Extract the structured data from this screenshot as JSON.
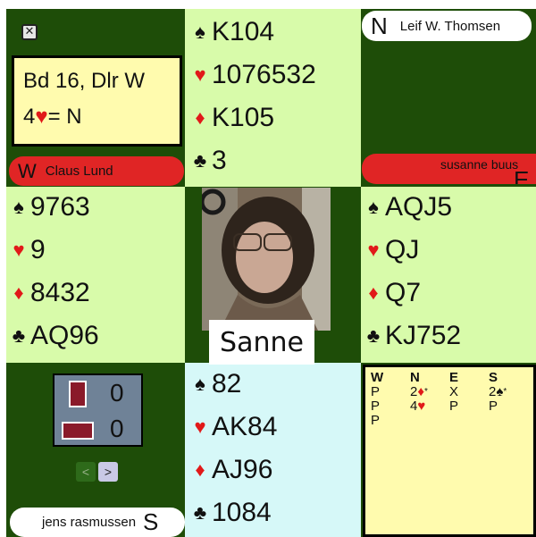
{
  "board": {
    "line1": "Bd 16, Dlr W",
    "level": "4",
    "suit_symbol": "♥",
    "declarer_text": "= N"
  },
  "players": {
    "north": {
      "seat": "N",
      "name": "Leif W. Thomsen"
    },
    "west": {
      "seat": "W",
      "name": "Claus Lund"
    },
    "east": {
      "seat": "E",
      "name": "susanne buus"
    },
    "south": {
      "seat": "S",
      "name": "jens rasmussen"
    }
  },
  "hands": {
    "north": [
      {
        "suit": "spades",
        "symbol": "♠",
        "cards": "K104",
        "color": "#111111"
      },
      {
        "suit": "hearts",
        "symbol": "♥",
        "cards": "1076532",
        "color": "#e11919"
      },
      {
        "suit": "diamonds",
        "symbol": "♦",
        "cards": "K105",
        "color": "#e11919"
      },
      {
        "suit": "clubs",
        "symbol": "♣",
        "cards": "3",
        "color": "#111111"
      }
    ],
    "west": [
      {
        "suit": "spades",
        "symbol": "♠",
        "cards": "9763",
        "color": "#111111"
      },
      {
        "suit": "hearts",
        "symbol": "♥",
        "cards": "9",
        "color": "#e11919"
      },
      {
        "suit": "diamonds",
        "symbol": "♦",
        "cards": "8432",
        "color": "#e11919"
      },
      {
        "suit": "clubs",
        "symbol": "♣",
        "cards": "AQ96",
        "color": "#111111"
      }
    ],
    "east": [
      {
        "suit": "spades",
        "symbol": "♠",
        "cards": "AQJ5",
        "color": "#111111"
      },
      {
        "suit": "hearts",
        "symbol": "♥",
        "cards": "QJ",
        "color": "#e11919"
      },
      {
        "suit": "diamonds",
        "symbol": "♦",
        "cards": "Q7",
        "color": "#e11919"
      },
      {
        "suit": "clubs",
        "symbol": "♣",
        "cards": "KJ752",
        "color": "#111111"
      }
    ],
    "south": [
      {
        "suit": "spades",
        "symbol": "♠",
        "cards": "82",
        "color": "#111111"
      },
      {
        "suit": "hearts",
        "symbol": "♥",
        "cards": "AK84",
        "color": "#e11919"
      },
      {
        "suit": "diamonds",
        "symbol": "♦",
        "cards": "AJ96",
        "color": "#e11919"
      },
      {
        "suit": "clubs",
        "symbol": "♣",
        "cards": "1084",
        "color": "#111111"
      }
    ]
  },
  "center": {
    "caption": "Sanne"
  },
  "score": {
    "ns_tricks": "0",
    "ew_tricks": "0"
  },
  "nav": {
    "prev": "<",
    "next": ">"
  },
  "bidding": {
    "headers": [
      "W",
      "N",
      "E",
      "S"
    ],
    "rows": [
      [
        {
          "t": "P"
        },
        {
          "t": "2",
          "s": "♦",
          "c": "#e11919",
          "a": "*"
        },
        {
          "t": "X"
        },
        {
          "t": "2",
          "s": "♠",
          "c": "#111111",
          "a": "*"
        }
      ],
      [
        {
          "t": "P"
        },
        {
          "t": "4",
          "s": "♥",
          "c": "#e11919"
        },
        {
          "t": "P"
        },
        {
          "t": "P"
        }
      ],
      [
        {
          "t": "P"
        }
      ]
    ]
  },
  "colors": {
    "table_green": "#1e4d08",
    "hand_bg": "#d8fbaa",
    "south_bg": "#d6f8f8",
    "west_bar": "#e02525",
    "card_yellow": "#fffbae"
  }
}
